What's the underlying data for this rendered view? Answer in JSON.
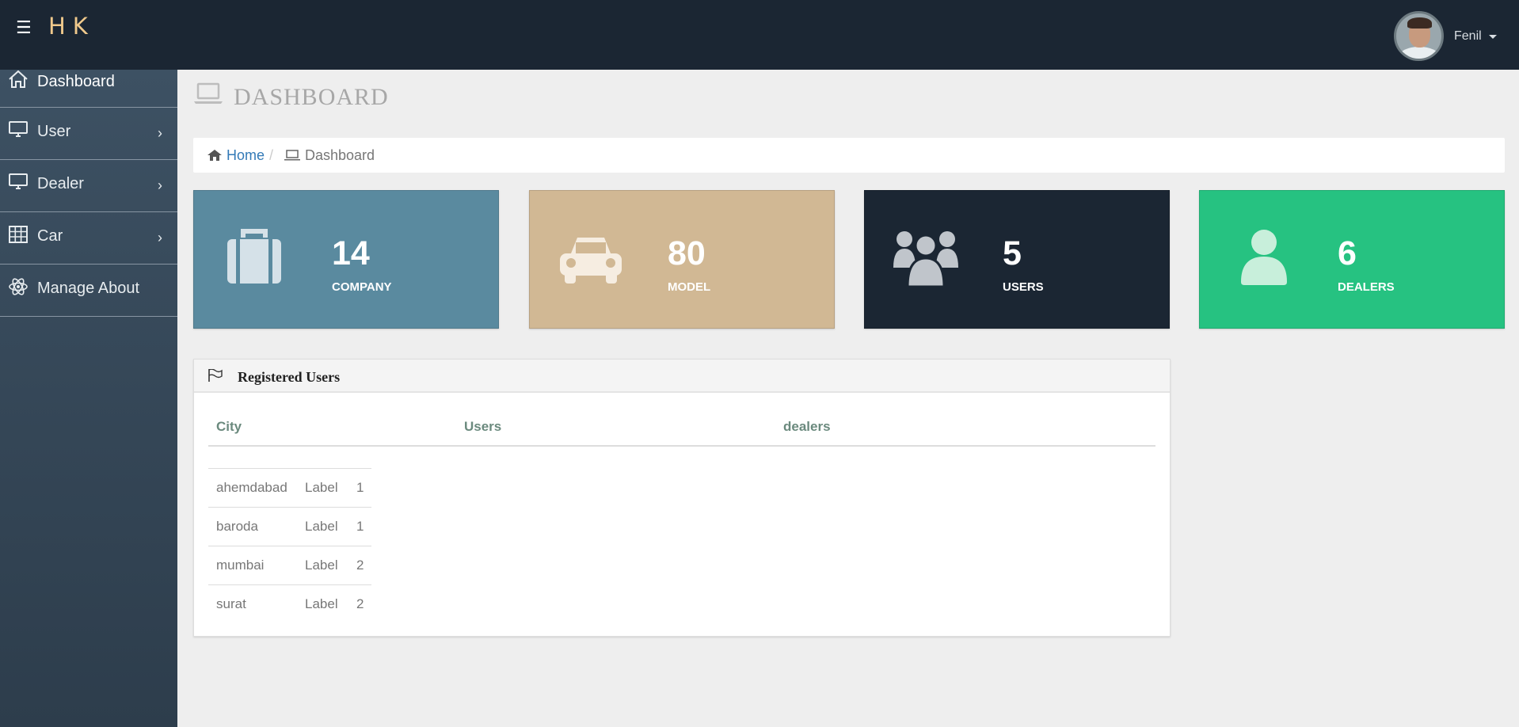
{
  "brand": "HK",
  "user": {
    "name": "Fenil"
  },
  "sidebar": {
    "items": [
      {
        "label": "Dashboard",
        "icon": "home-icon"
      },
      {
        "label": "User",
        "icon": "monitor-icon",
        "has_submenu": true
      },
      {
        "label": "Dealer",
        "icon": "monitor-icon",
        "has_submenu": true
      },
      {
        "label": "Car",
        "icon": "table-icon",
        "has_submenu": true
      },
      {
        "label": "Manage About",
        "icon": "atom-icon"
      }
    ]
  },
  "page": {
    "title": "DASHBOARD"
  },
  "breadcrumb": {
    "home": "Home",
    "current": "Dashboard"
  },
  "stats": [
    {
      "value": "14",
      "label": "COMPANY",
      "icon": "briefcase-icon",
      "color": "#5a8a9f"
    },
    {
      "value": "80",
      "label": "MODEL",
      "icon": "car-icon",
      "color": "#d1b894"
    },
    {
      "value": "5",
      "label": "USERS",
      "icon": "users-icon",
      "color": "#1b2633"
    },
    {
      "value": "6",
      "label": "DEALERS",
      "icon": "user-icon",
      "color": "#26c281"
    }
  ],
  "panel": {
    "title": "Registered Users",
    "columns": [
      "City",
      "Users",
      "dealers"
    ],
    "rows": [
      {
        "city": "ahemdabad",
        "label": "Label",
        "count": "1"
      },
      {
        "city": "baroda",
        "label": "Label",
        "count": "1"
      },
      {
        "city": "mumbai",
        "label": "Label",
        "count": "2"
      },
      {
        "city": "surat",
        "label": "Label",
        "count": "2"
      }
    ]
  },
  "colors": {
    "topbar": "#1b2633",
    "brand": "#f0c98c",
    "link": "#337ab7"
  }
}
